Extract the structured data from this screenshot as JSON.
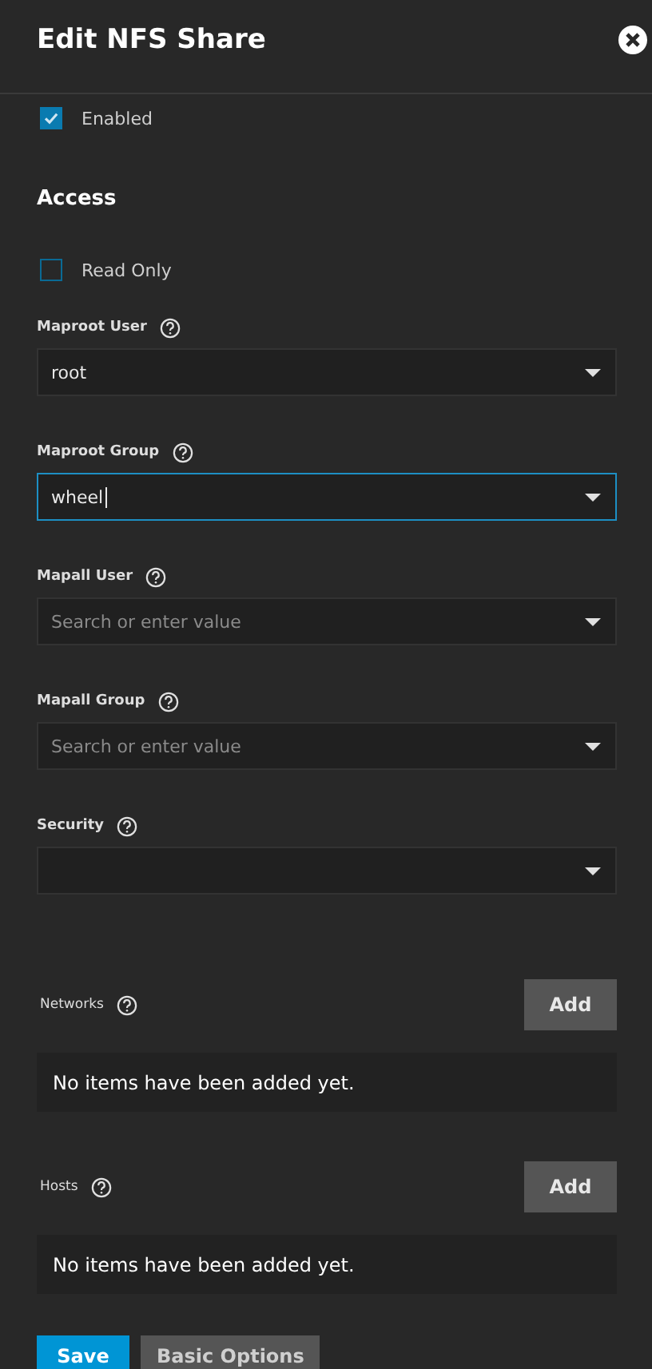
{
  "header": {
    "title": "Edit NFS Share"
  },
  "enabled": {
    "label": "Enabled",
    "checked": true
  },
  "access": {
    "heading": "Access",
    "read_only": {
      "label": "Read Only",
      "checked": false
    },
    "fields": [
      {
        "label": "Maproot User",
        "value": "root",
        "focused": false
      },
      {
        "label": "Maproot Group",
        "value": "wheel",
        "focused": true
      },
      {
        "label": "Mapall User",
        "placeholder": "Search or enter value",
        "focused": false
      },
      {
        "label": "Mapall Group",
        "placeholder": "Search or enter value",
        "focused": false
      },
      {
        "label": "Security",
        "focused": false
      }
    ]
  },
  "lists": [
    {
      "label": "Networks",
      "add_button": "Add",
      "empty_text": "No items have been added yet."
    },
    {
      "label": "Hosts",
      "add_button": "Add",
      "empty_text": "No items have been added yet."
    }
  ],
  "buttons": [
    {
      "label": "Save",
      "kind": "primary"
    },
    {
      "label": "Basic Options",
      "kind": "secondary"
    }
  ]
}
